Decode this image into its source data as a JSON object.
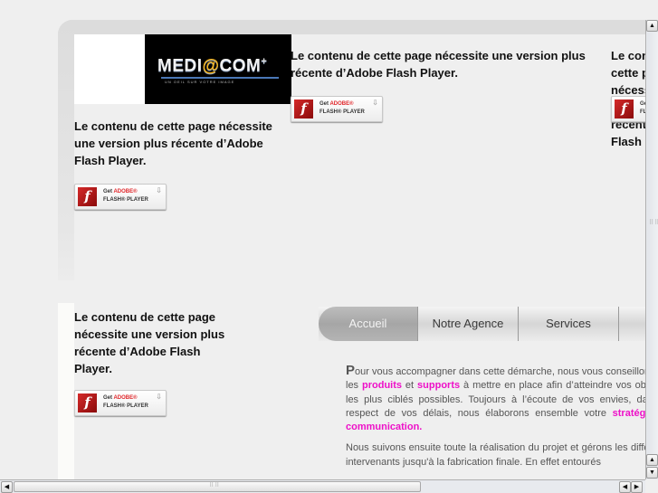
{
  "logo": {
    "brand_pre": "MEDI",
    "brand_at": "@",
    "brand_post": "COM",
    "brand_plus": "+",
    "tagline": "UN OEIL SUR VOTRE IMAGE"
  },
  "flash_notices": [
    {
      "message": "Le contenu de cette page nécessite une version plus récente d’Adobe Flash Player."
    },
    {
      "message": "Le contenu de cette page nécessite une version plus récente d’Adobe Flash Player."
    },
    {
      "message": "Le contenu de cette page nécessite une version plus récente d’Adobe Flash Player."
    },
    {
      "message": "Le contenu de cette page nécessite une version plus récente d’Adobe Flash Player."
    }
  ],
  "flash_button": {
    "icon": "f",
    "get": "Get ",
    "adobe": "ADOBE®",
    "player": "FLASH® PLAYER",
    "download_icon": "⇩"
  },
  "nav": {
    "tabs": [
      {
        "label": "Accueil",
        "active": true
      },
      {
        "label": "Notre Agence",
        "active": false
      },
      {
        "label": "Services",
        "active": false
      },
      {
        "label": "",
        "active": false
      }
    ]
  },
  "content": {
    "p1": {
      "dropcap": "P",
      "t1": "our vous accompagner dans cette démarche, nous vous conseillons sur les ",
      "hl1": "produits",
      "t2": " et ",
      "hl2": "supports",
      "t3": " à mettre en place afin d’atteindre vos objectifs les plus ciblés possibles. Toujours à l’écoute de vos envies, dans le respect de vos délais, nous élaborons ensemble votre ",
      "hl3": "stratégie de communication."
    },
    "p2": "Nous suivons ensuite toute la réalisation du projet et gérons les différents intervenants jusqu'à la fabrication finale. En effet entourés"
  },
  "scrollbars": {
    "up": "▲",
    "down": "▼",
    "left": "◀",
    "right": "▶",
    "grip": "⠿⠿"
  }
}
